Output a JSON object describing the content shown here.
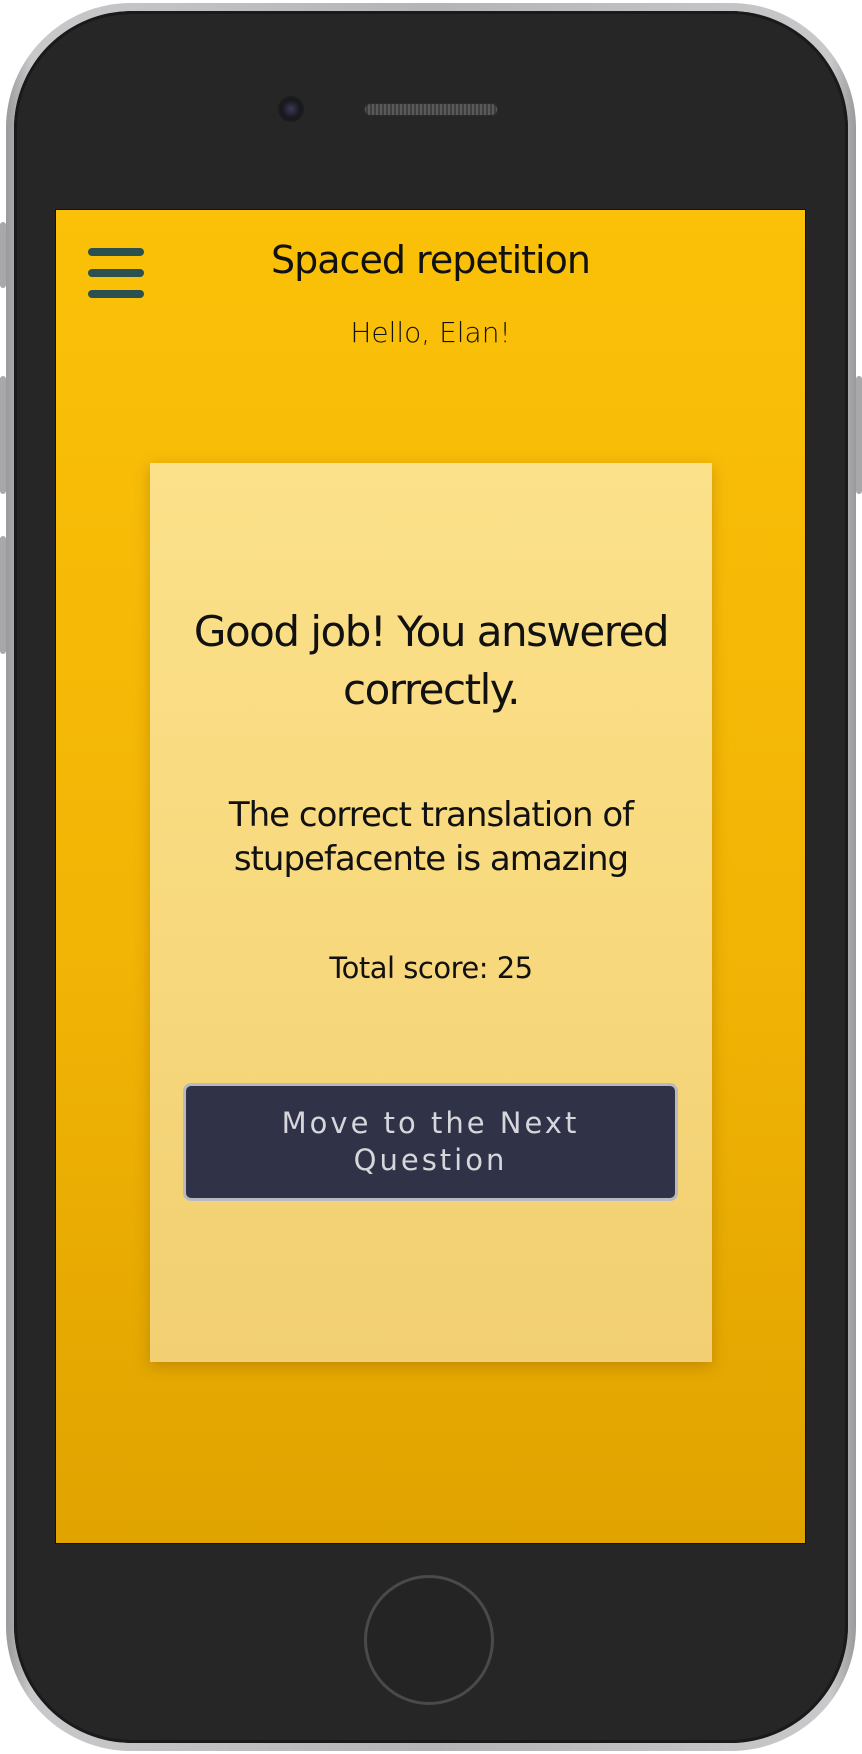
{
  "app": {
    "title": "Spaced repetition",
    "greeting": "Hello, Elan!"
  },
  "menu": {
    "icon": "hamburger-menu-icon"
  },
  "card": {
    "heading": "Good job! You answered correctly.",
    "translation_text": "The correct translation of stupefacente is amazing",
    "score_text": "Total score: 25",
    "next_button_label": "Move to the Next Question"
  },
  "colors": {
    "background": "#fbc108",
    "card": "#f8d97e",
    "button": "#303247",
    "menu_icon": "#2a5050"
  }
}
